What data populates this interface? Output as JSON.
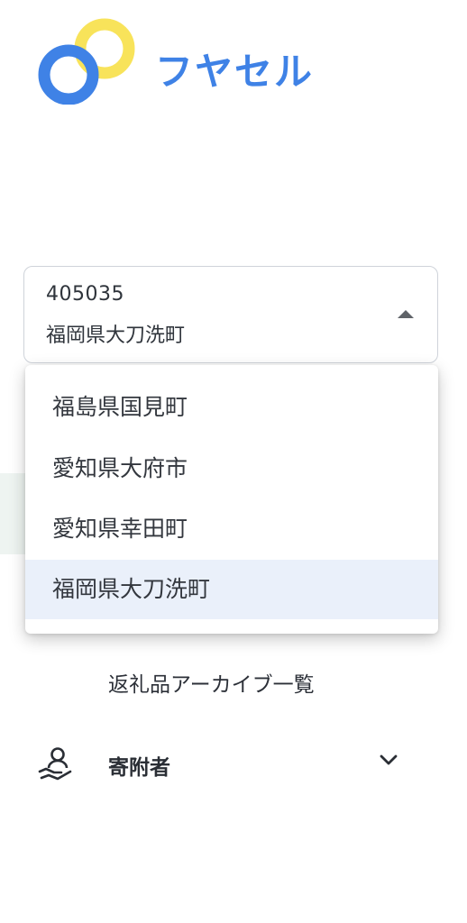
{
  "logo": {
    "text": "フヤセル",
    "colors": {
      "blue": "#3f82e6",
      "yellow": "#f8e35a"
    }
  },
  "select": {
    "code": "405035",
    "name": "福岡県大刀洗町"
  },
  "dropdown": {
    "options": [
      "福島県国見町",
      "愛知県大府市",
      "愛知県幸田町",
      "福岡県大刀洗町"
    ],
    "selected_index": 3
  },
  "nav": {
    "archive_label": "返礼品アーカイブ一覧",
    "donor_label": "寄附者",
    "donor_icon": "hand-person-icon",
    "chevron_icon": "chevron-down-icon"
  }
}
